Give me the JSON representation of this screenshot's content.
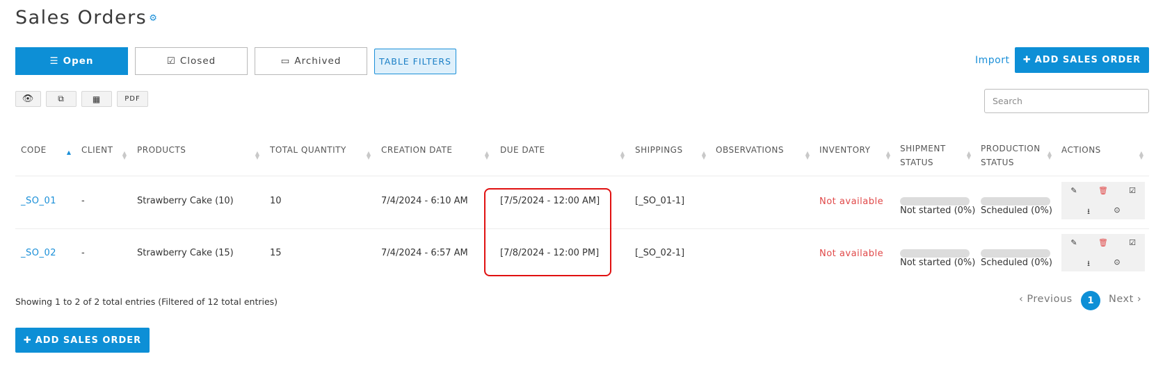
{
  "page": {
    "title": "Sales Orders"
  },
  "tabs": {
    "open": "Open",
    "closed": "Closed",
    "archived": "Archived"
  },
  "filters_label": "TABLE FILTERS",
  "import_label": "Import",
  "add_sales_order_label": "ADD SALES ORDER",
  "toolbar": {
    "pdf_label": "PDF"
  },
  "search": {
    "placeholder": "Search"
  },
  "table": {
    "headers": {
      "code": "CODE",
      "client": "CLIENT",
      "products": "PRODUCTS",
      "total_quantity": "TOTAL QUANTITY",
      "creation_date": "CREATION DATE",
      "due_date": "DUE DATE",
      "shippings": "SHIPPINGS",
      "observations": "OBSERVATIONS",
      "inventory": "INVENTORY",
      "shipment_status_1": "SHIPMENT",
      "shipment_status_2": "STATUS",
      "production_status_1": "PRODUCTION",
      "production_status_2": "STATUS",
      "actions": "ACTIONS"
    },
    "rows": [
      {
        "code": "_SO_01",
        "client": "-",
        "products": "Strawberry Cake (10)",
        "total_quantity": "10",
        "creation_date": "7/4/2024 - 6:10 AM",
        "due_date": "[7/5/2024 - 12:00 AM]",
        "shippings": "[_SO_01-1]",
        "observations": "",
        "inventory": "Not available",
        "shipment_status": "Not started (0%)",
        "shipment_progress": 0,
        "production_status": "Scheduled (0%)",
        "production_progress": 0
      },
      {
        "code": "_SO_02",
        "client": "-",
        "products": "Strawberry Cake (15)",
        "total_quantity": "15",
        "creation_date": "7/4/2024 - 6:57 AM",
        "due_date": "[7/8/2024 - 12:00 PM]",
        "shippings": "[_SO_02-1]",
        "observations": "",
        "inventory": "Not available",
        "shipment_status": "Not started (0%)",
        "shipment_progress": 0,
        "production_status": "Scheduled (0%)",
        "production_progress": 0
      }
    ]
  },
  "footer": {
    "showing": "Showing 1 to 2 of 2 total entries (Filtered of 12 total entries)",
    "previous": "Previous",
    "page": "1",
    "next": "Next"
  },
  "colors": {
    "accent": "#0d8fd6",
    "danger": "#e04848",
    "highlight": "#e01010"
  },
  "icons": [
    "gear-icon",
    "list-icon",
    "check-square-icon",
    "inbox-icon",
    "plus-icon",
    "eye-icon",
    "copy-icon",
    "table-icon",
    "sort-icon",
    "edit-icon",
    "trash-icon",
    "download-icon",
    "history-icon",
    "chevron-left-icon",
    "chevron-right-icon"
  ]
}
